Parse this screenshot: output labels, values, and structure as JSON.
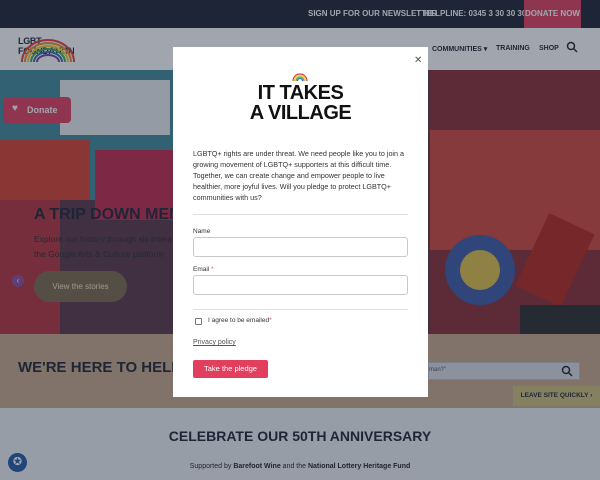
{
  "topbar": {
    "newsletter": "SIGN UP FOR OUR NEWSLETTER",
    "helpline": "HELPLINE: 0345 3 30 30 30",
    "donate_now": "DONATE NOW"
  },
  "nav": {
    "logo_text": "LGBT FOUNDATION",
    "communities": "COMMUNITIES",
    "training": "TRAINING",
    "shop": "SHOP",
    "search_icon": "search-icon"
  },
  "donate_float": {
    "label": "Donate",
    "icon": "heart-icon"
  },
  "hero": {
    "title": "A TRIP DOWN MEMOR",
    "text": "Explore our history through six intera the Google Arts & Culture platform",
    "button": "View the stories"
  },
  "help": {
    "title": "WE'RE HERE TO HELP!",
    "search_placeholder": "man?\"",
    "leave_site": "LEAVE SITE QUICKLY  ›"
  },
  "anniversary": {
    "title": "CELEBRATE OUR 50TH ANNIVERSARY",
    "supported_prefix": "Supported by ",
    "sponsor1": "Barefoot Wine",
    "and": " and the ",
    "sponsor2": "National Lottery Heritage Fund"
  },
  "modal": {
    "title_line1": "IT TAKES",
    "title_line2": "A VILLAGE",
    "intro": "LGBTQ+ rights are under threat. We need people like you to join a growing movement of LGBTQ+ supporters at this difficult time. Together, we can create change and empower people to live healthier, more joyful lives. Will you pledge to protect LGBTQ+ communities with us?",
    "name_label": "Name",
    "email_label": "Email",
    "required_mark": "*",
    "checkbox_label": "I agree to be emailed",
    "privacy_link": "Privacy policy",
    "pledge_button": "Take the pledge",
    "close_icon": "close-icon"
  },
  "colors": {
    "brand_pink": "#e23f5e",
    "navy": "#1c2433"
  }
}
